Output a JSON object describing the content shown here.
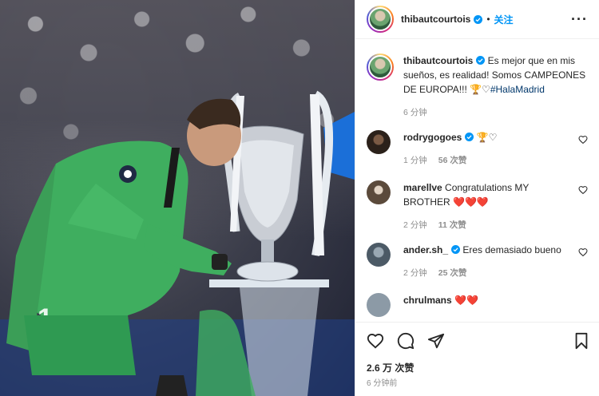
{
  "post": {
    "photo_alt": "Goalkeeper kissing the European Cup trophy",
    "likes_label": "2.6 万 次赞",
    "time_label": "6 分钟前"
  },
  "header": {
    "username": "thibautcourtois",
    "dot": "•",
    "follow_label": "关注",
    "more_label": "···"
  },
  "caption": {
    "username": "thibautcourtois",
    "text": " Es mejor que en mis sueños, es realidad! Somos CAMPEONES DE EUROPA!!! ",
    "emoji": "🏆♡",
    "hashtag": "#HalaMadrid",
    "time": "6 分钟"
  },
  "comments": [
    {
      "username": "rodrygogoes",
      "verified": true,
      "text": " 🏆♡",
      "time": "1 分钟",
      "likes": "56 次赞",
      "avatar_color": "#3a2a20"
    },
    {
      "username": "marellve",
      "verified": false,
      "text": " Congratulations MY BROTHER ",
      "hearts": "❤️❤️❤️",
      "time": "2 分钟",
      "likes": "11 次赞",
      "avatar_color": "#5b4a3b"
    },
    {
      "username": "ander.sh_",
      "verified": true,
      "text": " Eres demasiado bueno",
      "time": "2 分钟",
      "likes": "25 次赞",
      "avatar_color": "#4c5a66"
    },
    {
      "username": "chrulmans",
      "verified": false,
      "text": " ❤️❤️",
      "time": "",
      "likes": "",
      "avatar_color": "#8c9aa6"
    }
  ],
  "colors": {
    "link": "#0095f6",
    "hashtag": "#00376b",
    "muted": "#8e8e8e",
    "verified": "#0095f6",
    "kit_green": "#3fae5f"
  },
  "icons": [
    "verified-badge-icon",
    "heart-icon",
    "comment-icon",
    "share-icon",
    "save-icon",
    "more-icon"
  ]
}
